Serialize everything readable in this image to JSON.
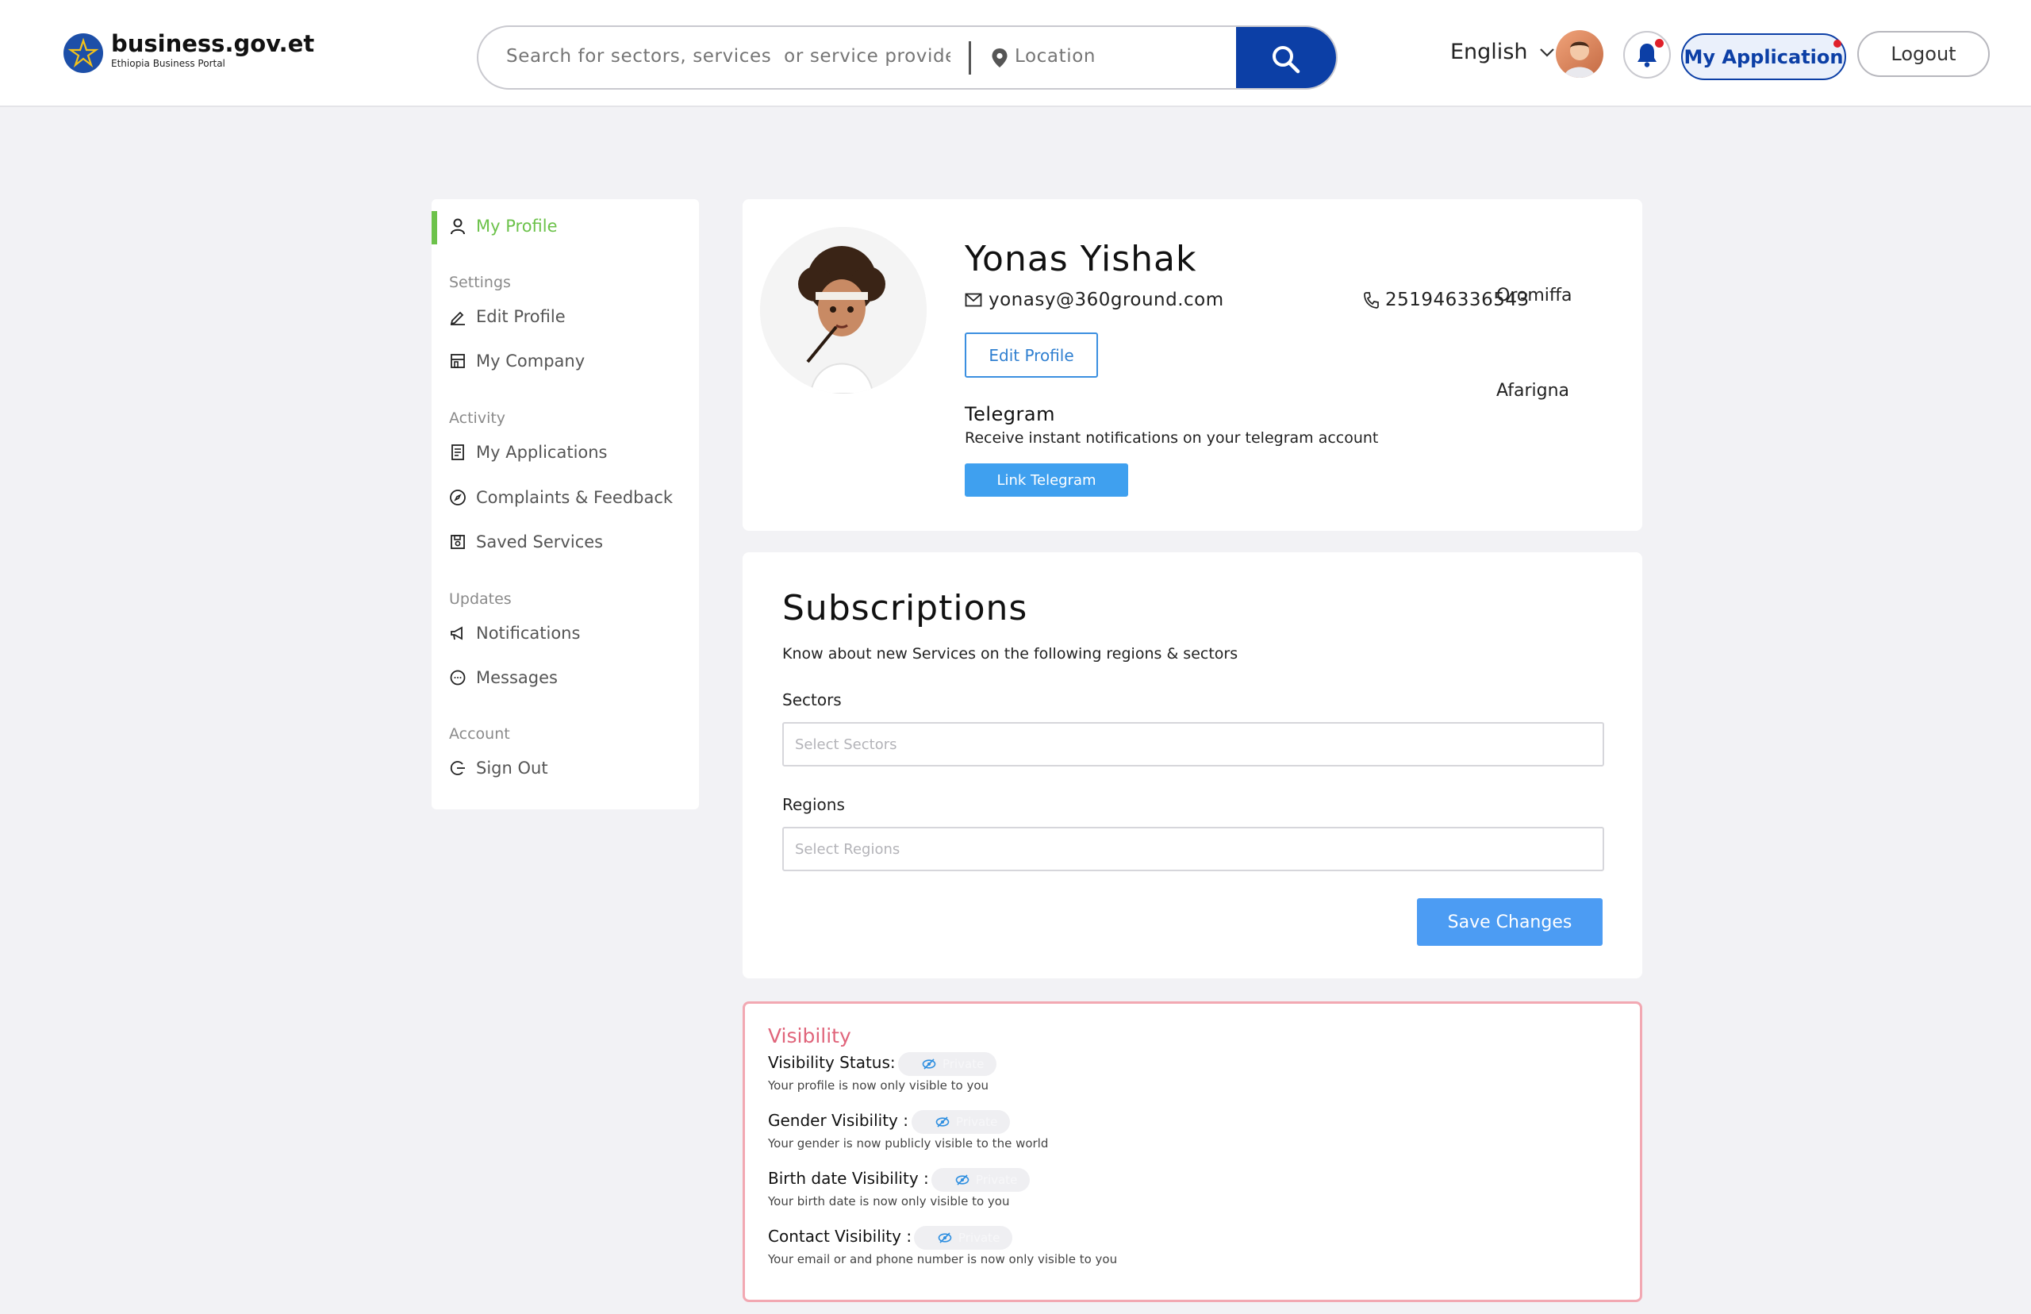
{
  "header": {
    "logo_title": "business.gov.et",
    "logo_subtitle": "Ethiopia Business Portal",
    "search_placeholder": "Search for sectors, services  or service providers",
    "location_placeholder": "Location",
    "language": "English",
    "my_application_label": "My Application",
    "logout_label": "Logout",
    "accent_color": "#0c3fa6"
  },
  "sidebar": {
    "my_profile": "My Profile",
    "settings_section": "Settings",
    "edit_profile": "Edit Profile",
    "my_company": "My Company",
    "activity_section": "Activity",
    "my_applications": "My Applications",
    "complaints": "Complaints & Feedback",
    "saved_services": "Saved Services",
    "updates_section": "Updates",
    "notifications": "Notifications",
    "messages": "Messages",
    "account_section": "Account",
    "sign_out": "Sign Out",
    "active_color": "#6cc24a"
  },
  "profile": {
    "name": "Yonas Yishak",
    "email": "yonasy@360ground.com",
    "phone": "251946336543",
    "languages": [
      "Oromiffa",
      "Afarigna"
    ],
    "edit_profile_label": "Edit Profile",
    "telegram_title": "Telegram",
    "telegram_desc": "Receive instant notifications on your telegram account",
    "link_telegram_label": "Link Telegram"
  },
  "subscriptions": {
    "title": "Subscriptions",
    "description": "Know about new Services on the following regions & sectors",
    "sectors_label": "Sectors",
    "sectors_placeholder": "Select Sectors",
    "regions_label": "Regions",
    "regions_placeholder": "Select Regions",
    "save_label": "Save Changes"
  },
  "visibility": {
    "title": "Visibility",
    "title_color": "#e0657b",
    "rows": [
      {
        "label": "Visibility Status:",
        "toggle": "Private",
        "desc": "Your profile is now only visible to you"
      },
      {
        "label": "Gender Visibility :",
        "toggle": "Private",
        "desc": "Your gender is now publicly visible to the world"
      },
      {
        "label": "Birth date Visibility :",
        "toggle": "Private",
        "desc": "Your birth date is now only visible to you"
      },
      {
        "label": "Contact Visibility :",
        "toggle": "Private",
        "desc": "Your email or and phone number is now only visible to you"
      }
    ]
  }
}
